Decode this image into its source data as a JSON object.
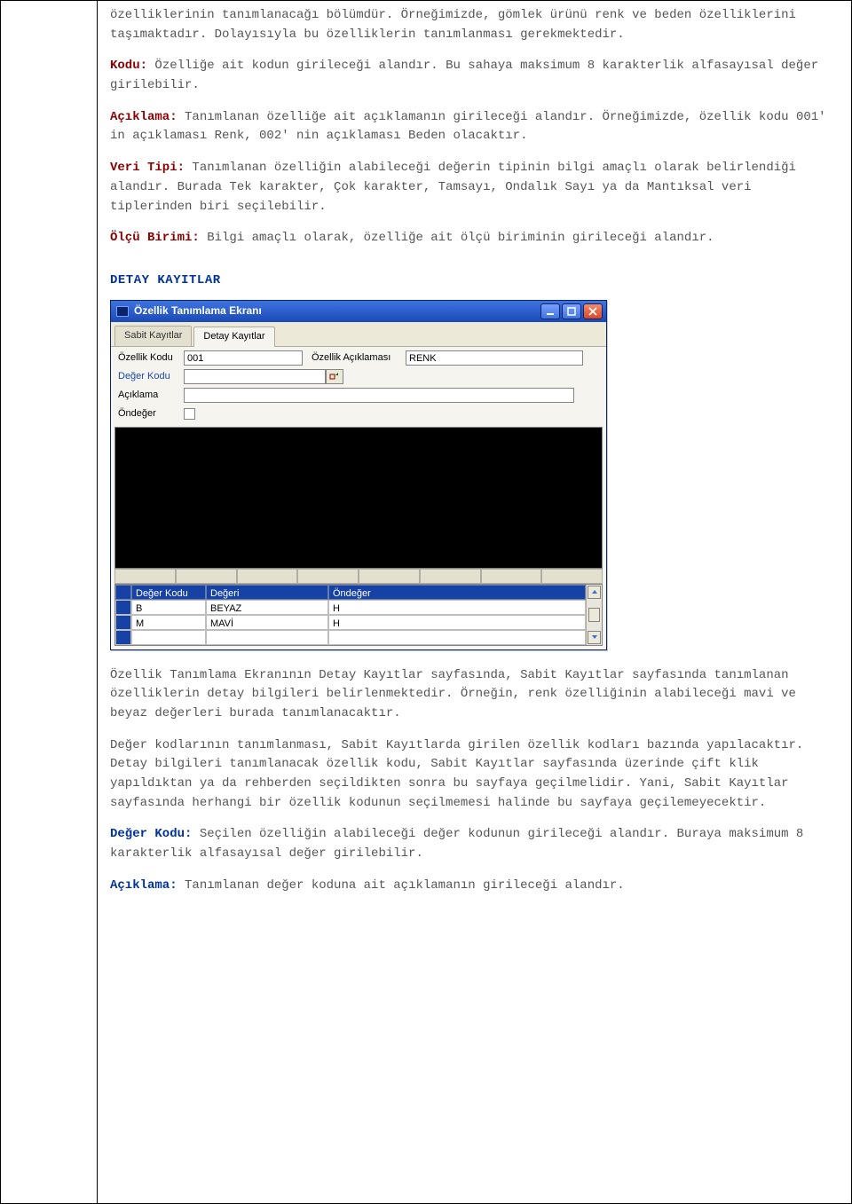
{
  "doc": {
    "p1": "özelliklerinin tanımlanacağı bölümdür. Örneğimizde, gömlek ürünü renk ve beden özelliklerini taşımaktadır. Dolayısıyla bu özelliklerin tanımlanması gerekmektedir.",
    "kodu_label": "Kodu:",
    "kodu_text": " Özelliğe ait kodun girileceği alandır. Bu sahaya maksimum 8 karakterlik alfasayısal değer girilebilir.",
    "aciklama_label": "Açıklama:",
    "aciklama_text": " Tanımlanan özelliğe ait açıklamanın girileceği alandır. Örneğimizde, özellik kodu 001' in açıklaması Renk, 002' nin açıklaması Beden olacaktır.",
    "veritipi_label": "Veri Tipi:",
    "veritipi_text": " Tanımlanan özelliğin alabileceği değerin tipinin bilgi amaçlı olarak belirlendiği alandır. Burada Tek karakter, Çok karakter, Tamsayı, Ondalık Sayı ya da Mantıksal veri tiplerinden biri seçilebilir.",
    "olcu_label": "Ölçü Birimi:",
    "olcu_text": " Bilgi amaçlı olarak, özelliğe ait ölçü biriminin girileceği alandır.",
    "section": "DETAY KAYITLAR",
    "after1": "Özellik Tanımlama Ekranının Detay Kayıtlar sayfasında, Sabit Kayıtlar sayfasında tanımlanan özelliklerin detay bilgileri belirlenmektedir. Örneğin, renk özelliğinin alabileceği mavi ve beyaz değerleri burada tanımlanacaktır.",
    "after2": "Değer kodlarının tanımlanması, Sabit Kayıtlarda girilen özellik kodları bazında yapılacaktır. Detay bilgileri tanımlanacak özellik kodu, Sabit Kayıtlar sayfasında üzerinde çift klik yapıldıktan ya da rehberden seçildikten sonra bu sayfaya geçilmelidir. Yani, Sabit Kayıtlar sayfasında herhangi bir özellik kodunun seçilmemesi halinde bu sayfaya geçilemeyecektir.",
    "degerkodu2_label": "Değer Kodu:",
    "degerkodu2_text": " Seçilen özelliğin alabileceği değer kodunun girileceği alandır. Buraya maksimum 8 karakterlik alfasayısal değer girilebilir.",
    "aciklama2_label": "Açıklama:",
    "aciklama2_text": " Tanımlanan değer koduna ait açıklamanın girileceği alandır."
  },
  "dialog": {
    "title": "Özellik Tanımlama Ekranı",
    "tabs": {
      "sabit": "Sabit Kayıtlar",
      "detay": "Detay Kayıtlar"
    },
    "labels": {
      "ozellik_kodu": "Özellik Kodu",
      "ozellik_aciklamasi": "Özellik Açıklaması",
      "deger_kodu": "Değer Kodu",
      "aciklama": "Açıklama",
      "ondeger": "Öndeğer"
    },
    "values": {
      "ozellik_kodu": "001",
      "ozellik_aciklamasi": "RENK",
      "deger_kodu": "",
      "aciklama": ""
    },
    "grid": {
      "head": [
        "Değer Kodu",
        "Değeri",
        "Öndeğer"
      ],
      "rows": [
        {
          "deger_kodu": "B",
          "degeri": "BEYAZ",
          "ondeger": "H"
        },
        {
          "deger_kodu": "M",
          "degeri": "MAVİ",
          "ondeger": "H"
        }
      ]
    }
  }
}
